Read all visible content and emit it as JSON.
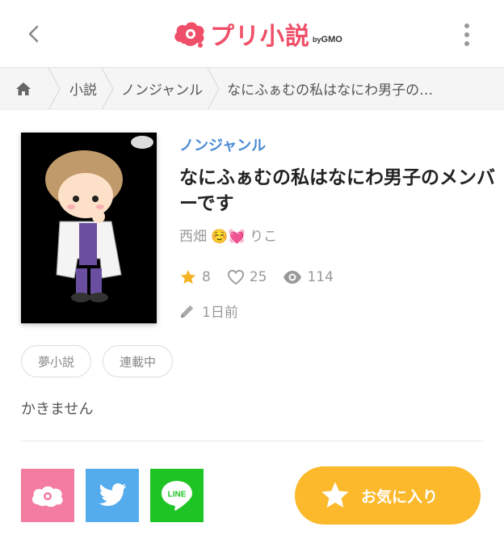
{
  "header": {
    "logo_text": "プリ小説",
    "logo_sub_by": "by",
    "logo_sub_brand": "GMO"
  },
  "breadcrumb": {
    "items": [
      "小説",
      "ノンジャンル",
      "なにふぁむの私はなにわ男子の…"
    ]
  },
  "novel": {
    "genre": "ノンジャンル",
    "title": "なにふぁむの私はなにわ男子のメンバーです",
    "author": "西畑 ☺️💓 りこ",
    "stars": "8",
    "likes": "25",
    "views": "114",
    "updated": "1日前",
    "tags": [
      "夢小説",
      "連載中"
    ],
    "summary": "かきません"
  },
  "actions": {
    "favorite_label": "お気に入り"
  },
  "colors": {
    "brand": "#ef4f68",
    "genre": "#4a8bd4",
    "favorite": "#fcb92c",
    "prin": "#f37ca0",
    "twitter": "#54aced",
    "line": "#1ec423"
  },
  "icons": {
    "back": "chevron-left-icon",
    "menu": "more-vertical-icon",
    "home": "home-icon",
    "star": "star-icon",
    "heart": "heart-icon",
    "eye": "eye-icon",
    "pencil": "pencil-icon"
  }
}
